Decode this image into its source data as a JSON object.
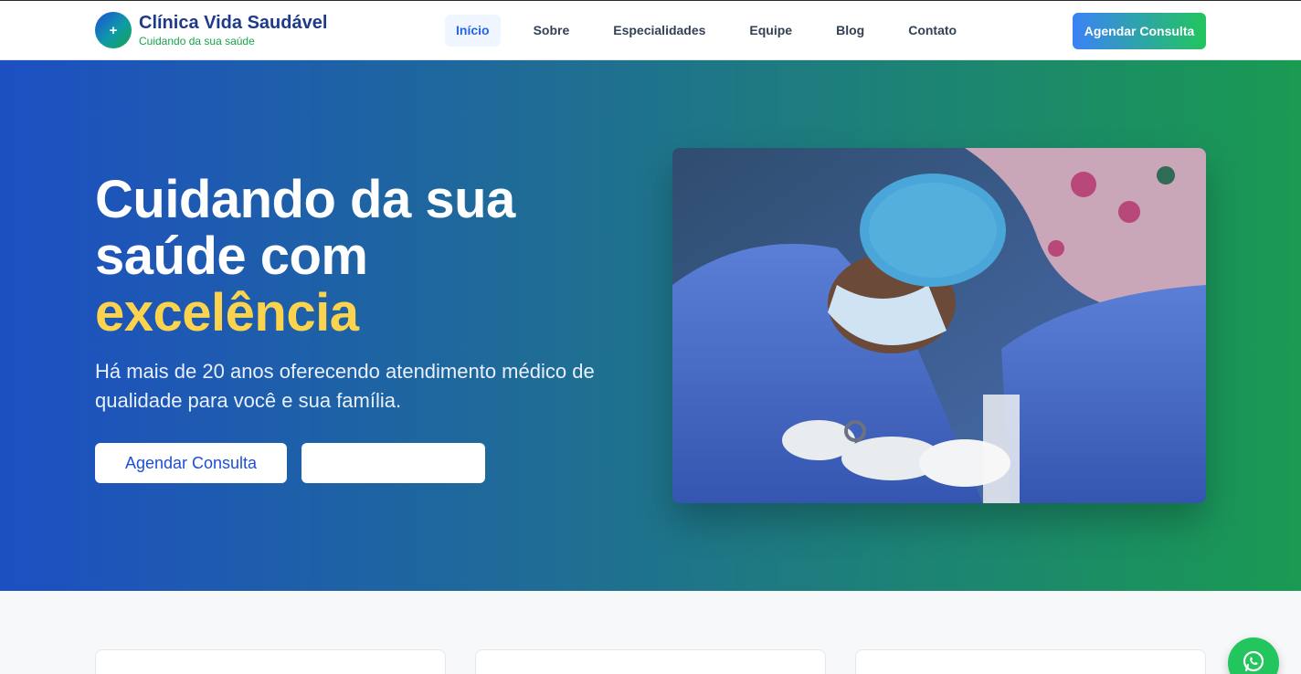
{
  "brand": {
    "logo_symbol": "+",
    "name": "Clínica Vida Saudável",
    "tagline": "Cuidando da sua saúde"
  },
  "nav": {
    "items": [
      {
        "label": "Início",
        "active": true
      },
      {
        "label": "Sobre",
        "active": false
      },
      {
        "label": "Especialidades",
        "active": false
      },
      {
        "label": "Equipe",
        "active": false
      },
      {
        "label": "Blog",
        "active": false
      },
      {
        "label": "Contato",
        "active": false
      }
    ],
    "cta_label": "Agendar Consulta"
  },
  "hero": {
    "title_line1": "Cuidando da sua",
    "title_line2": "saúde com",
    "title_accent": "excelência",
    "subtitle": "Há mais de 20 anos oferecendo atendimento médico de qualidade para você e sua família.",
    "primary_button": "Agendar Consulta",
    "secondary_button": "",
    "image_icon": "surgery-photo"
  },
  "colors": {
    "accent_blue": "#2563eb",
    "accent_green": "#16a34a",
    "highlight_yellow": "#fcd34d",
    "whatsapp_green": "#22c55e"
  },
  "floating": {
    "whatsapp_icon": "whatsapp-icon"
  }
}
